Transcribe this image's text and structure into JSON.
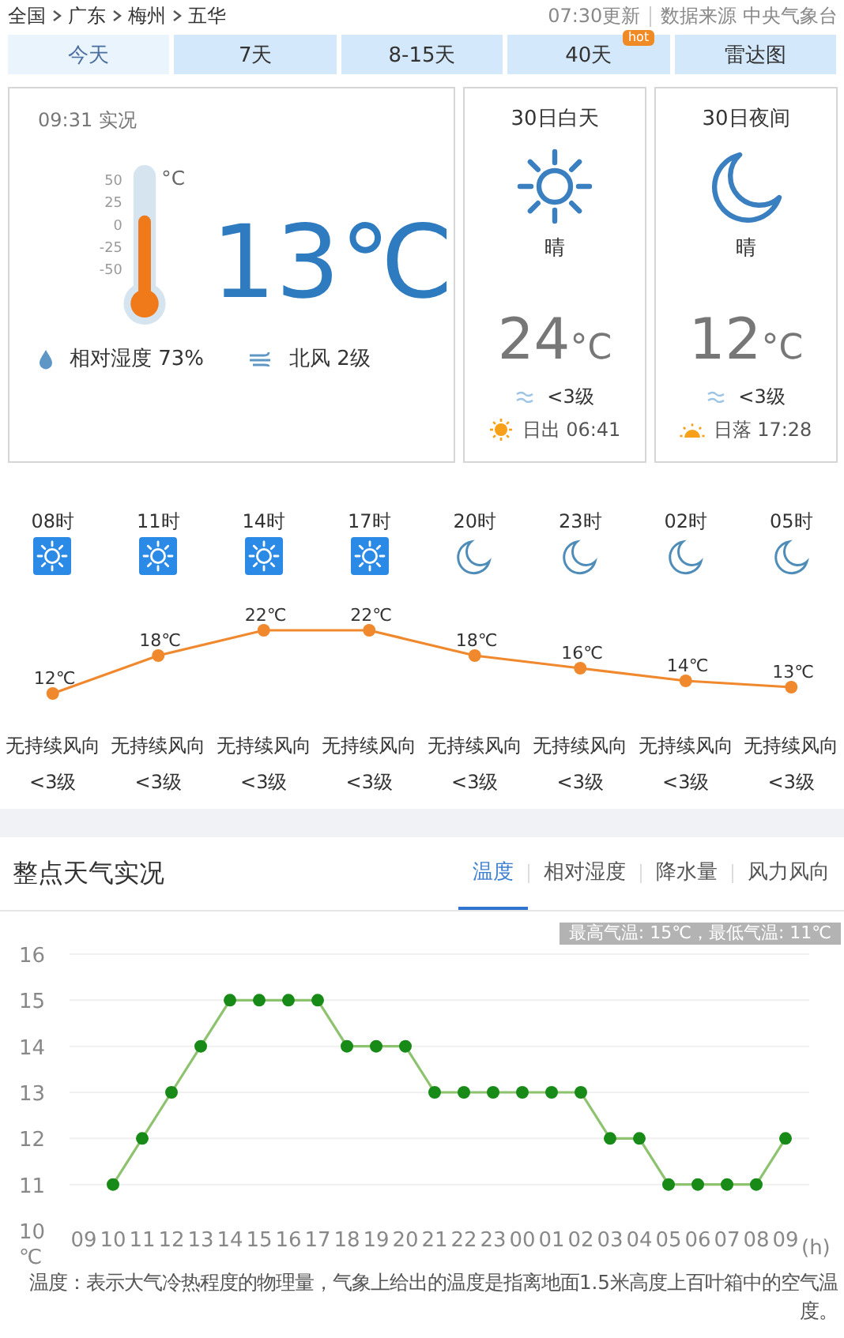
{
  "breadcrumb": [
    "全国",
    "广东",
    "梅州",
    "五华"
  ],
  "update_time": "07:30更新",
  "source": "数据来源 中央气象台",
  "tabs": [
    {
      "label": "今天",
      "selected": true
    },
    {
      "label": "7天",
      "selected": false
    },
    {
      "label": "8-15天",
      "selected": false
    },
    {
      "label": "40天",
      "selected": false,
      "badge": "hot"
    },
    {
      "label": "雷达图",
      "selected": false
    }
  ],
  "now": {
    "time": "09:31 实况",
    "thermometer": {
      "unit": "°C",
      "ticks": [
        "50",
        "25",
        "0",
        "-25",
        "-50"
      ]
    },
    "temp": "13",
    "temp_unit": "℃",
    "humidity": "相对湿度  73%",
    "wind": "北风  2级"
  },
  "periods": [
    {
      "title": "30日白天",
      "kind": "day",
      "condition": "晴",
      "temp": "24",
      "temp_unit": "°C",
      "wind": "<3级",
      "sun_text": "日出 06:41"
    },
    {
      "title": "30日夜间",
      "kind": "night",
      "condition": "晴",
      "temp": "12",
      "temp_unit": "°C",
      "wind": "<3级",
      "sun_text": "日落 17:28"
    }
  ],
  "hourly": {
    "items": [
      {
        "time": "08时",
        "kind": "day",
        "wind_dir": "无持续风向",
        "wind_level": "<3级"
      },
      {
        "time": "11时",
        "kind": "day",
        "wind_dir": "无持续风向",
        "wind_level": "<3级"
      },
      {
        "time": "14时",
        "kind": "day",
        "wind_dir": "无持续风向",
        "wind_level": "<3级"
      },
      {
        "time": "17时",
        "kind": "day",
        "wind_dir": "无持续风向",
        "wind_level": "<3级"
      },
      {
        "time": "20时",
        "kind": "night",
        "wind_dir": "无持续风向",
        "wind_level": "<3级"
      },
      {
        "time": "23时",
        "kind": "night",
        "wind_dir": "无持续风向",
        "wind_level": "<3级"
      },
      {
        "time": "02时",
        "kind": "night",
        "wind_dir": "无持续风向",
        "wind_level": "<3级"
      },
      {
        "time": "05时",
        "kind": "night",
        "wind_dir": "无持续风向",
        "wind_level": "<3级"
      }
    ],
    "chart_data": {
      "type": "line",
      "series": [
        {
          "color": "#f0892d",
          "marker": "circle",
          "values": [
            12,
            18,
            22,
            22,
            18,
            16,
            14,
            13
          ]
        }
      ],
      "data_labels": true
    },
    "temp_unit": "℃"
  },
  "observations": {
    "title": "整点天气实况",
    "tabs": [
      {
        "label": "温度",
        "selected": true
      },
      {
        "label": "相对湿度",
        "selected": false
      },
      {
        "label": "降水量",
        "selected": false
      },
      {
        "label": "风力风向",
        "selected": false
      }
    ],
    "summary": "最高气温: 15℃，最低气温: 11℃",
    "chart_data": {
      "type": "line",
      "xlabel": "(h)",
      "ylabel": "℃",
      "categories": [
        "09",
        "10",
        "11",
        "12",
        "13",
        "14",
        "15",
        "16",
        "17",
        "18",
        "19",
        "20",
        "21",
        "22",
        "23",
        "00",
        "01",
        "02",
        "03",
        "04",
        "05",
        "06",
        "07",
        "08",
        "09"
      ],
      "grid": true,
      "series": [
        {
          "color": "#8dc26f",
          "marker": "circle",
          "values": [
            null,
            11,
            12,
            13,
            14,
            15,
            15,
            15,
            15,
            14,
            14,
            14,
            13,
            13,
            13,
            13,
            13,
            13,
            12,
            12,
            11,
            11,
            11,
            11,
            12
          ]
        }
      ],
      "ylim": [
        10,
        16
      ],
      "yticks": [
        10,
        11,
        12,
        13,
        14,
        15,
        16
      ]
    },
    "note": "温度：表示大气冷热程度的物理量，气象上给出的温度是指离地面1.5米高度上百叶箱中的空气温度。"
  }
}
